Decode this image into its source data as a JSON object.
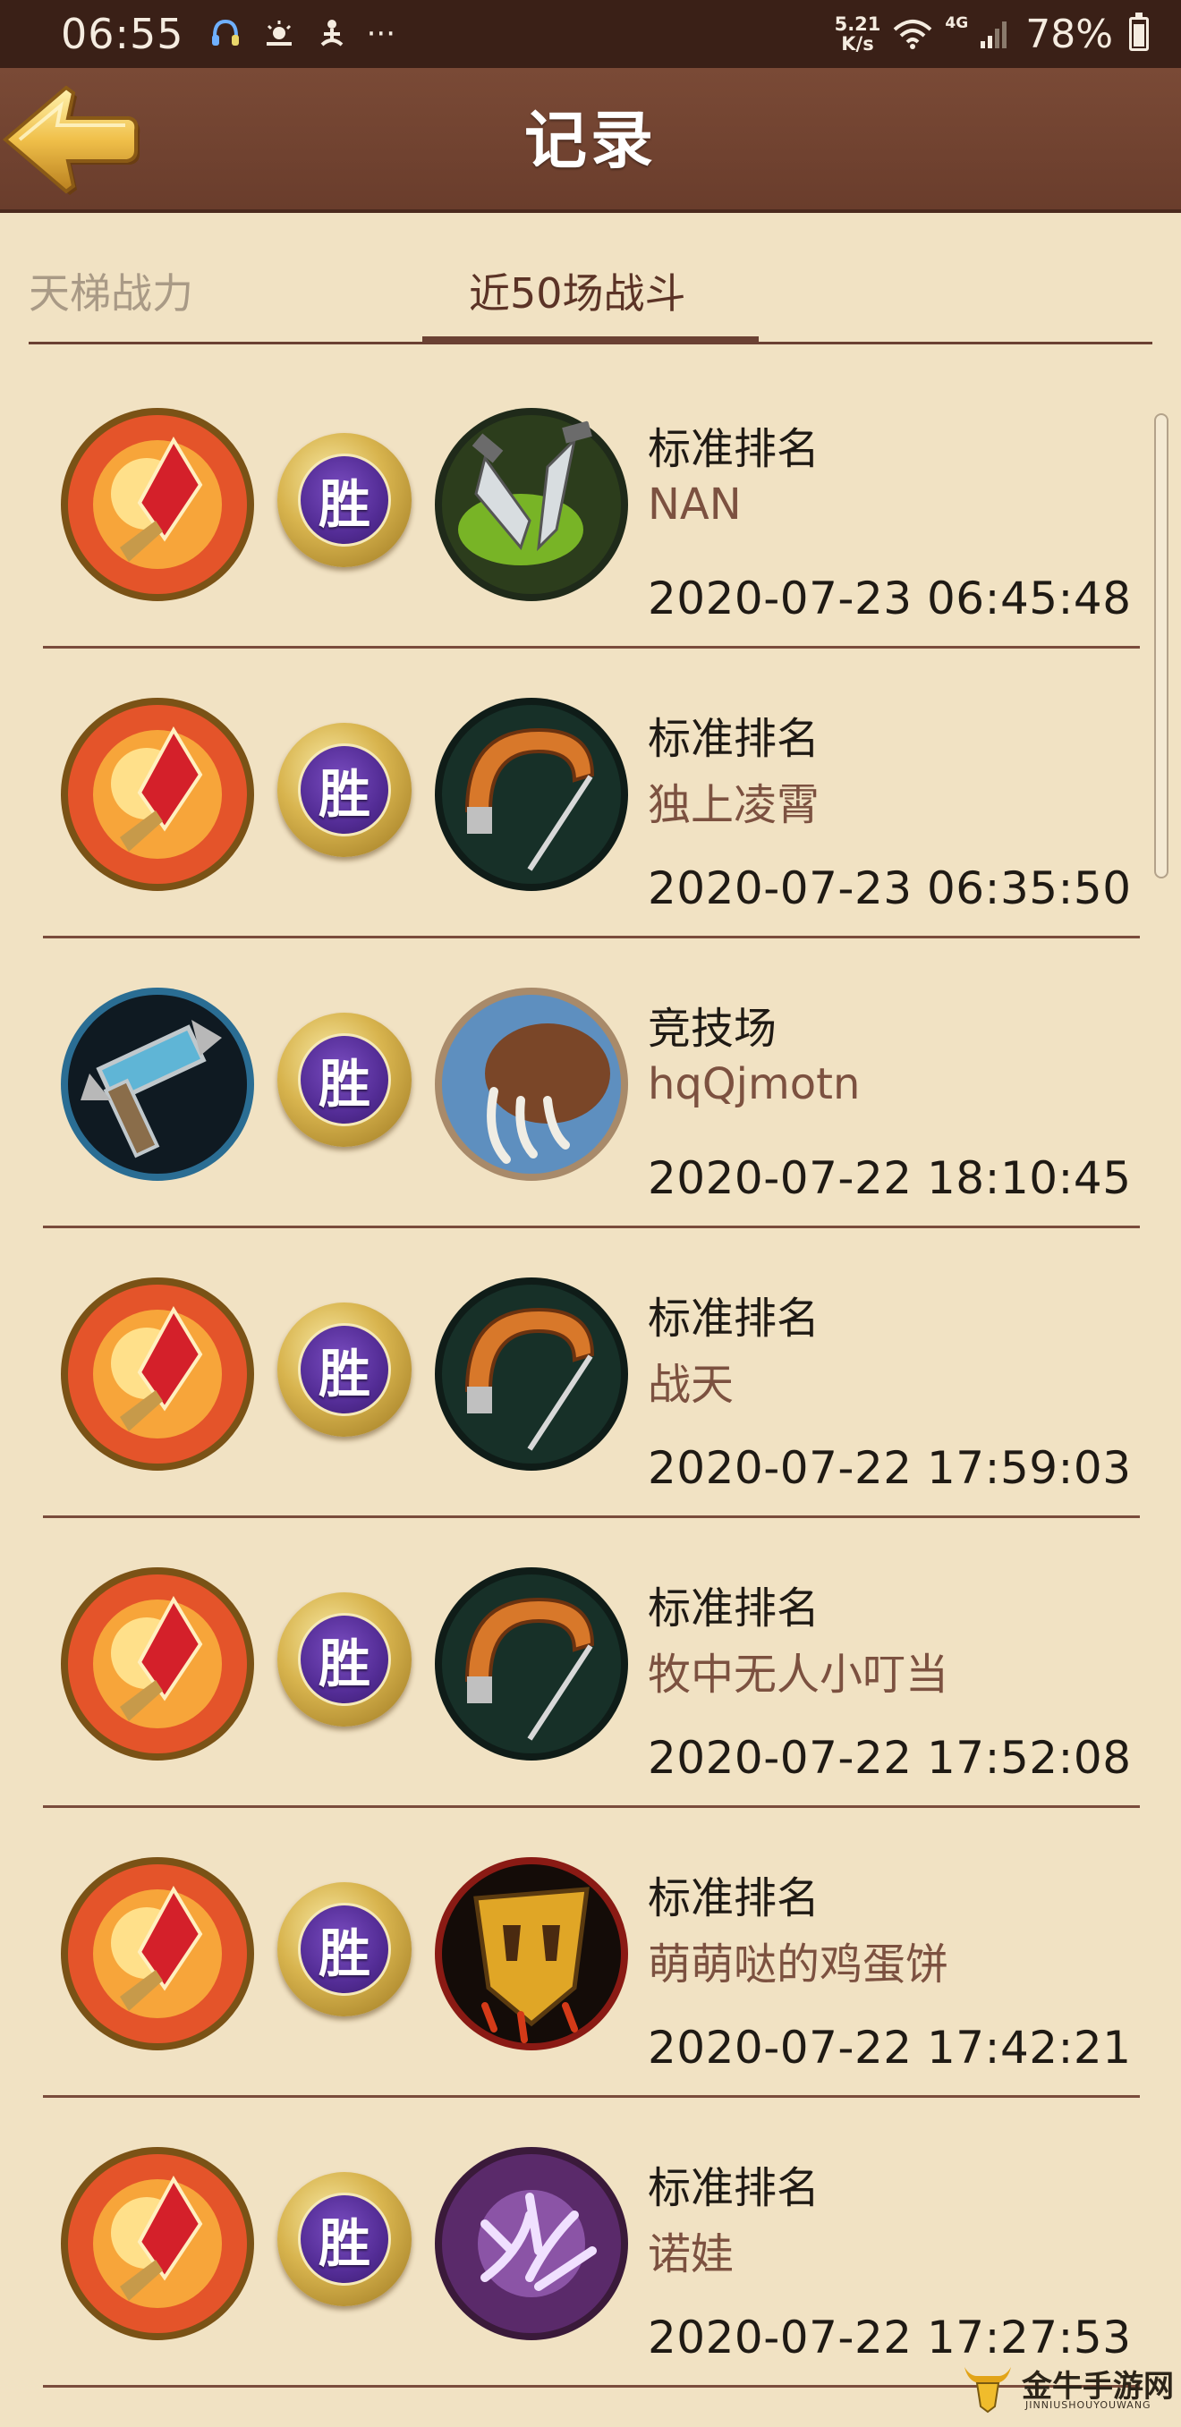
{
  "status_bar": {
    "time": "06:55",
    "notification_icons": [
      "headset-icon",
      "weather-icon",
      "meditation-icon",
      "more-icon"
    ],
    "more_glyph": "···",
    "net_speed_value": "5.21",
    "net_speed_unit": "K/s",
    "net_type": "4G",
    "battery_percent": "78%",
    "battery_level": 0.78
  },
  "header": {
    "title": "记录",
    "back_icon": "back-arrow-icon"
  },
  "tabs": [
    {
      "label": "天梯战力",
      "selected": false
    },
    {
      "label": "近50场战斗",
      "selected": true
    }
  ],
  "records": [
    {
      "hero_icon": "fire-crystal-icon",
      "result": "胜",
      "opponent_icon": "twin-daggers-icon",
      "mode": "标准排名",
      "opponent": "NAN",
      "datetime": "2020-07-23 06:45:48"
    },
    {
      "hero_icon": "fire-crystal-icon",
      "result": "胜",
      "opponent_icon": "hook-icon",
      "mode": "标准排名",
      "opponent": "独上凌霄",
      "datetime": "2020-07-23 06:35:50"
    },
    {
      "hero_icon": "frost-hammer-icon",
      "result": "胜",
      "opponent_icon": "claw-icon",
      "mode": "竞技场",
      "opponent": "hqQjmotn",
      "datetime": "2020-07-22 18:10:45"
    },
    {
      "hero_icon": "fire-crystal-icon",
      "result": "胜",
      "opponent_icon": "hook-icon",
      "mode": "标准排名",
      "opponent": "战天",
      "datetime": "2020-07-22 17:59:03"
    },
    {
      "hero_icon": "fire-crystal-icon",
      "result": "胜",
      "opponent_icon": "hook-icon",
      "mode": "标准排名",
      "opponent": "牧中无人小叮当",
      "datetime": "2020-07-22 17:52:08"
    },
    {
      "hero_icon": "fire-crystal-icon",
      "result": "胜",
      "opponent_icon": "horde-emblem-icon",
      "mode": "标准排名",
      "opponent": "萌萌哒的鸡蛋饼",
      "datetime": "2020-07-22 17:42:21"
    },
    {
      "hero_icon": "fire-crystal-icon",
      "result": "胜",
      "opponent_icon": "shadow-hand-icon",
      "mode": "标准排名",
      "opponent": "诺娃",
      "datetime": "2020-07-22 17:27:53"
    }
  ],
  "watermark": {
    "text": "金牛手游网",
    "subtext": "JINNIUSHOUYOUWANG"
  },
  "colors": {
    "background": "#f1e2c3",
    "header": "#6a3d2c",
    "status_bar": "#3a2017",
    "opponent_name": "#7c5140",
    "result_badge": "#532c95"
  }
}
